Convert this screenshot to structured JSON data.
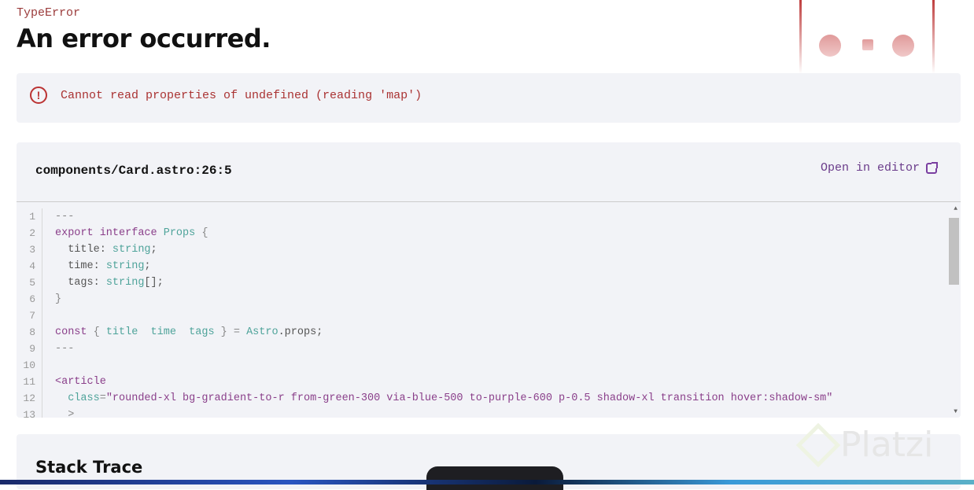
{
  "error_type": "TypeError",
  "title": "An error occurred.",
  "message": "Cannot read properties of undefined (reading 'map')",
  "message_icon": "alert-circle-icon",
  "file": "components/Card.astro:26:5",
  "open_in_editor": "Open in editor",
  "code_lines": [
    {
      "n": "1",
      "tokens": [
        [
          "---",
          "p"
        ]
      ]
    },
    {
      "n": "2",
      "tokens": [
        [
          "export interface ",
          "k"
        ],
        [
          "Props",
          "t"
        ],
        [
          " {",
          "p"
        ]
      ]
    },
    {
      "n": "3",
      "tokens": [
        [
          "  title: ",
          "s"
        ],
        [
          "string",
          "t"
        ],
        [
          ";",
          "s"
        ]
      ]
    },
    {
      "n": "4",
      "tokens": [
        [
          "  time: ",
          "s"
        ],
        [
          "string",
          "t"
        ],
        [
          ";",
          "s"
        ]
      ]
    },
    {
      "n": "5",
      "tokens": [
        [
          "  tags: ",
          "s"
        ],
        [
          "string",
          "t"
        ],
        [
          "[];",
          "s"
        ]
      ]
    },
    {
      "n": "6",
      "tokens": [
        [
          "}",
          "p"
        ]
      ]
    },
    {
      "n": "7",
      "tokens": []
    },
    {
      "n": "8",
      "tokens": [
        [
          "const ",
          "k"
        ],
        [
          "{ ",
          "p"
        ],
        [
          "title",
          "t"
        ],
        [
          "  ",
          "s"
        ],
        [
          "time",
          "t"
        ],
        [
          "  ",
          "s"
        ],
        [
          "tags",
          "t"
        ],
        [
          " } = ",
          "p"
        ],
        [
          "Astro",
          "t"
        ],
        [
          ".props;",
          "s"
        ]
      ]
    },
    {
      "n": "9",
      "tokens": [
        [
          "---",
          "p"
        ]
      ]
    },
    {
      "n": "10",
      "tokens": []
    },
    {
      "n": "11",
      "tokens": [
        [
          "<article",
          "k"
        ]
      ]
    },
    {
      "n": "12",
      "tokens": [
        [
          "  class",
          "t"
        ],
        [
          "=",
          "p"
        ],
        [
          "\"rounded-xl bg-gradient-to-r from-green-300 via-blue-500 to-purple-600 p-0.5 shadow-xl transition hover:shadow-sm\"",
          "k"
        ]
      ]
    },
    {
      "n": "13",
      "tokens": [
        [
          "  >",
          "p"
        ]
      ]
    }
  ],
  "stack_title": "Stack Trace",
  "watermark": "Platzi"
}
